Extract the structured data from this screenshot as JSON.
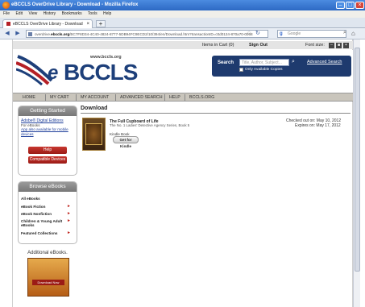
{
  "window": {
    "title": "eBCCLS OverDrive Library - Download - Mozilla Firefox",
    "menu": [
      "File",
      "Edit",
      "View",
      "History",
      "Bookmarks",
      "Tools",
      "Help"
    ],
    "tab_label": "eBCCLS OverDrive Library - Download",
    "new_tab": "+",
    "url_pre": "overdrive.",
    "url_host": "ebccls.org",
    "url_rest": "/BC7F8D34-4C40-4824-8777-5DB94FC9ECD2/10/394/en/Download.htm?transactionID=c0d0124-870a70-0068",
    "search_placeholder": "Google"
  },
  "header": {
    "items_in_cart": "Items in Cart",
    "cart_count": "(0)",
    "sign_out": "Sign Out",
    "font_size": "Font size:",
    "site_url": "www.bccls.org",
    "logo_e": "e",
    "logo_rest": "BCCLS",
    "search_label": "Search",
    "search_placeholder": "Title, Author, Subject...",
    "advanced_search": "Advanced Search",
    "only_available": "Only Available Copies"
  },
  "nav": [
    "HOME",
    "MY CART",
    "MY ACCOUNT",
    "ADVANCED SEARCH",
    "HELP",
    "BCCLS.ORG"
  ],
  "sidebar": {
    "getting_started": "Getting Started",
    "adobe": "Adobe® Digital Editions",
    "for_ebooks": "For eBooks",
    "app_link": "App also available for mobile devices",
    "help": "Help",
    "compatible": "Compatible Devices",
    "browse": "Browse eBooks",
    "browse_items": [
      "All eBooks",
      "eBook Fiction",
      "eBook Nonfiction",
      "Children & Young Adult eBooks",
      "Featured Collections"
    ],
    "additional": "Additional eBooks.",
    "download_now": "Download Now"
  },
  "main": {
    "title": "Download",
    "book_title": "The Full Cupboard of Life",
    "book_sub": "The No. 1 Ladies' Detective Agency Series, Book 5",
    "format": "Kindle Book",
    "kindle_button": "Get for Kindle",
    "checked_out": "Checked out on: May 10, 2012",
    "expires": "Expires on: May 17, 2012"
  }
}
